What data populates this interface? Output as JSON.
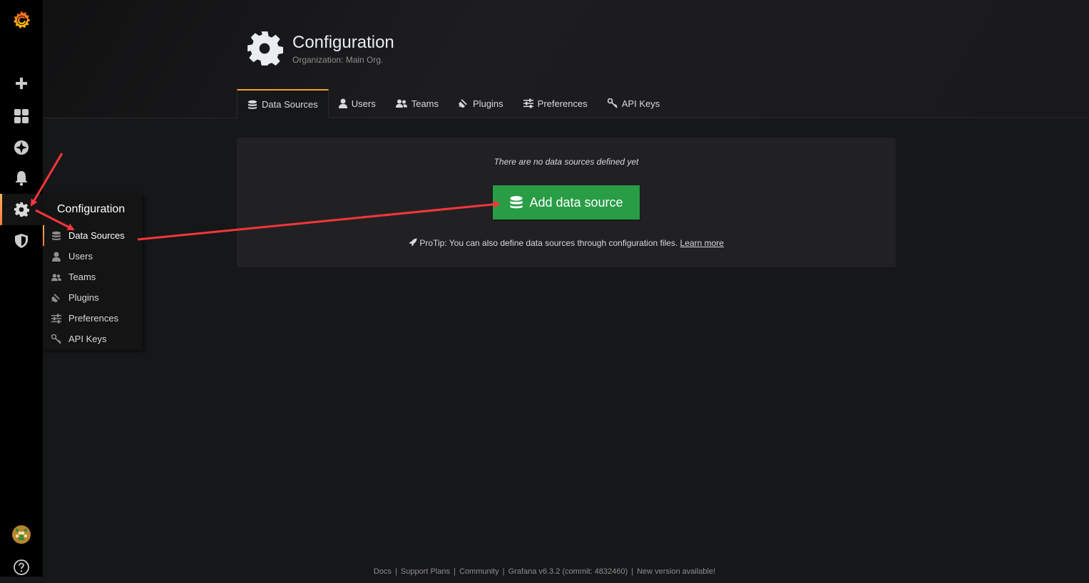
{
  "sidebar": {
    "items": [
      {
        "name": "grafana-logo"
      },
      {
        "name": "create"
      },
      {
        "name": "dashboards"
      },
      {
        "name": "explore"
      },
      {
        "name": "alerting"
      },
      {
        "name": "configuration"
      },
      {
        "name": "server-admin"
      },
      {
        "name": "profile"
      },
      {
        "name": "help"
      }
    ]
  },
  "header": {
    "title": "Configuration",
    "subtitle": "Organization: Main Org."
  },
  "tabs": [
    {
      "label": "Data Sources",
      "icon": "database-icon",
      "active": true
    },
    {
      "label": "Users",
      "icon": "user-icon"
    },
    {
      "label": "Teams",
      "icon": "users-icon"
    },
    {
      "label": "Plugins",
      "icon": "plug-icon"
    },
    {
      "label": "Preferences",
      "icon": "sliders-icon"
    },
    {
      "label": "API Keys",
      "icon": "key-icon"
    }
  ],
  "main": {
    "empty_text": "There are no data sources defined yet",
    "add_button": "Add data source",
    "protip_text": "ProTip: You can also define data sources through configuration files.",
    "learn_more": "Learn more"
  },
  "flyout": {
    "title": "Configuration",
    "items": [
      {
        "label": "Data Sources",
        "icon": "database-icon",
        "active": true
      },
      {
        "label": "Users",
        "icon": "user-icon"
      },
      {
        "label": "Teams",
        "icon": "users-icon"
      },
      {
        "label": "Plugins",
        "icon": "plug-icon"
      },
      {
        "label": "Preferences",
        "icon": "sliders-icon"
      },
      {
        "label": "API Keys",
        "icon": "key-icon"
      }
    ]
  },
  "footer": {
    "docs": "Docs",
    "support": "Support Plans",
    "community": "Community",
    "version": "Grafana v6.3.2 (commit: 4832460)",
    "new_version": "New version available!"
  },
  "colors": {
    "accent": "#f89e28",
    "button": "#299c46",
    "annotation_arrow": "#f5363c"
  }
}
